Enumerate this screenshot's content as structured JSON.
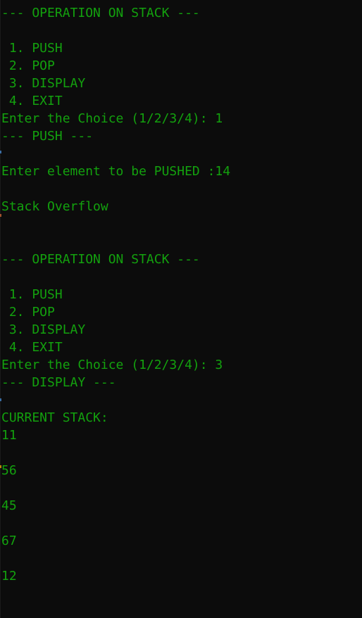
{
  "terminal": {
    "lines": [
      "--- OPERATION ON STACK ---",
      "",
      " 1. PUSH",
      " 2. POP",
      " 3. DISPLAY",
      " 4. EXIT",
      "Enter the Choice (1/2/3/4): 1",
      "--- PUSH ---",
      "",
      "Enter element to be PUSHED :14",
      "",
      "Stack Overflow",
      "",
      "",
      "--- OPERATION ON STACK ---",
      "",
      " 1. PUSH",
      " 2. POP",
      " 3. DISPLAY",
      " 4. EXIT",
      "Enter the Choice (1/2/3/4): 3",
      "--- DISPLAY ---",
      "",
      "CURRENT STACK:",
      "11",
      "",
      "56",
      "",
      "45",
      "",
      "67",
      "",
      "12"
    ]
  },
  "colors": {
    "background": "#0c0c0c",
    "text": "#13a10e"
  }
}
